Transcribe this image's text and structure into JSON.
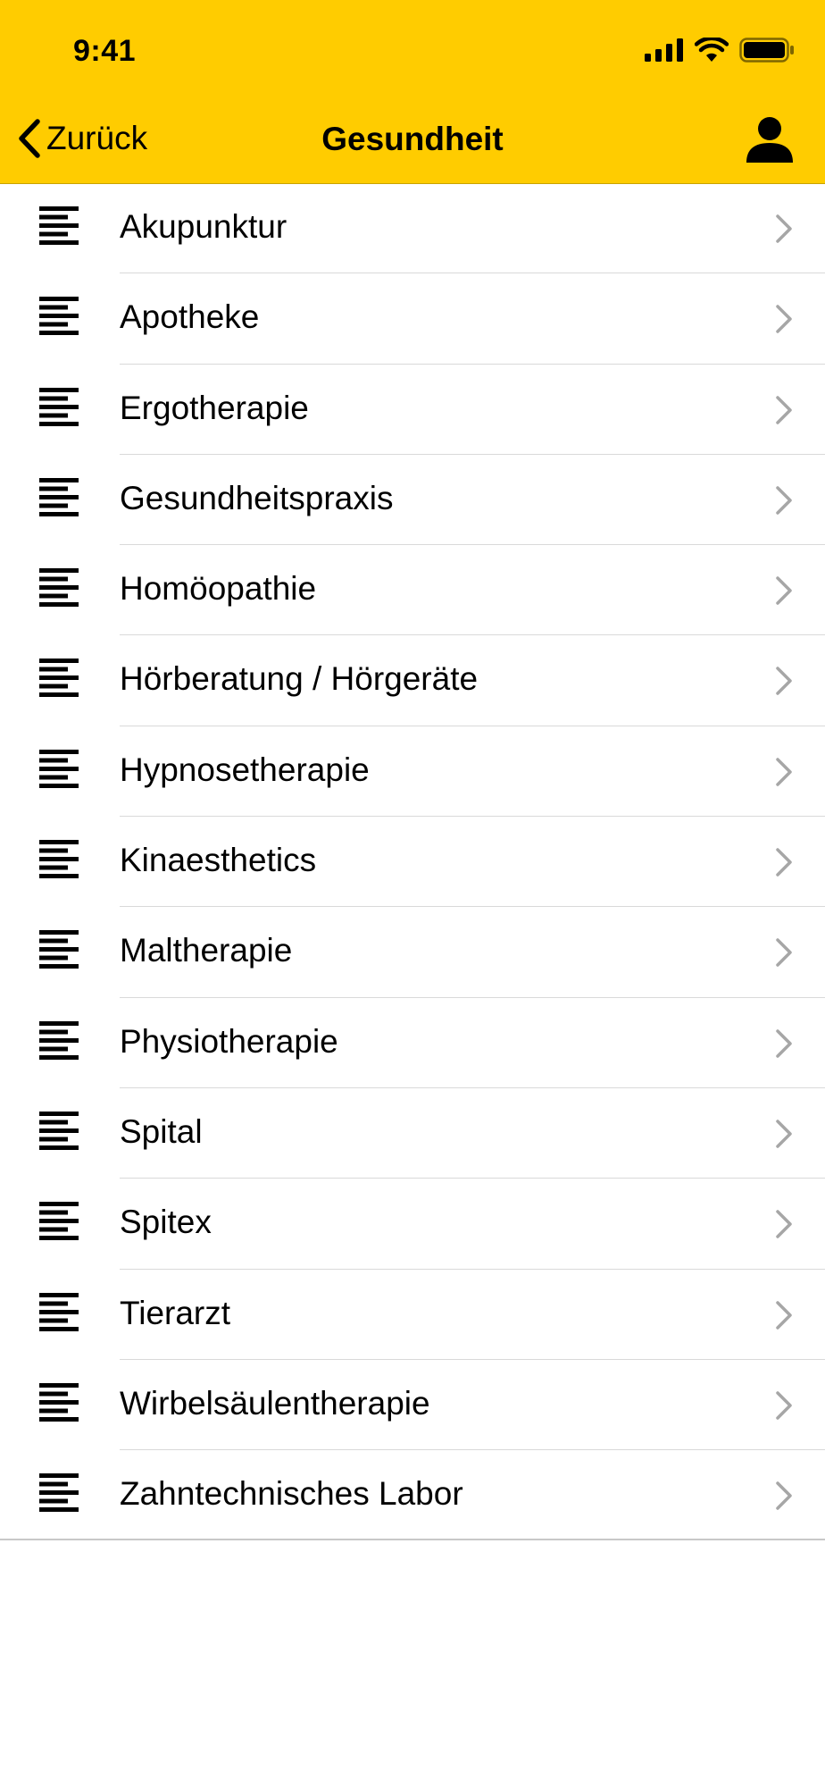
{
  "status_bar": {
    "time": "9:41",
    "icons": [
      "cellular-signal-icon",
      "wifi-icon",
      "battery-icon"
    ]
  },
  "nav": {
    "back_label": "Zurück",
    "title": "Gesundheit",
    "profile_icon": "person-icon"
  },
  "colors": {
    "header_background": "#FFCC00",
    "chevron": "#a6a6a6",
    "separator": "#d9d9d9"
  },
  "categories": [
    {
      "label": "Akupunktur"
    },
    {
      "label": "Apotheke"
    },
    {
      "label": "Ergotherapie"
    },
    {
      "label": "Gesundheitspraxis"
    },
    {
      "label": "Homöopathie"
    },
    {
      "label": "Hörberatung / Hörgeräte"
    },
    {
      "label": "Hypnosetherapie"
    },
    {
      "label": "Kinaesthetics"
    },
    {
      "label": "Maltherapie"
    },
    {
      "label": "Physiotherapie"
    },
    {
      "label": "Spital"
    },
    {
      "label": "Spitex"
    },
    {
      "label": "Tierarzt"
    },
    {
      "label": "Wirbelsäulentherapie"
    },
    {
      "label": "Zahntechnisches Labor"
    }
  ]
}
